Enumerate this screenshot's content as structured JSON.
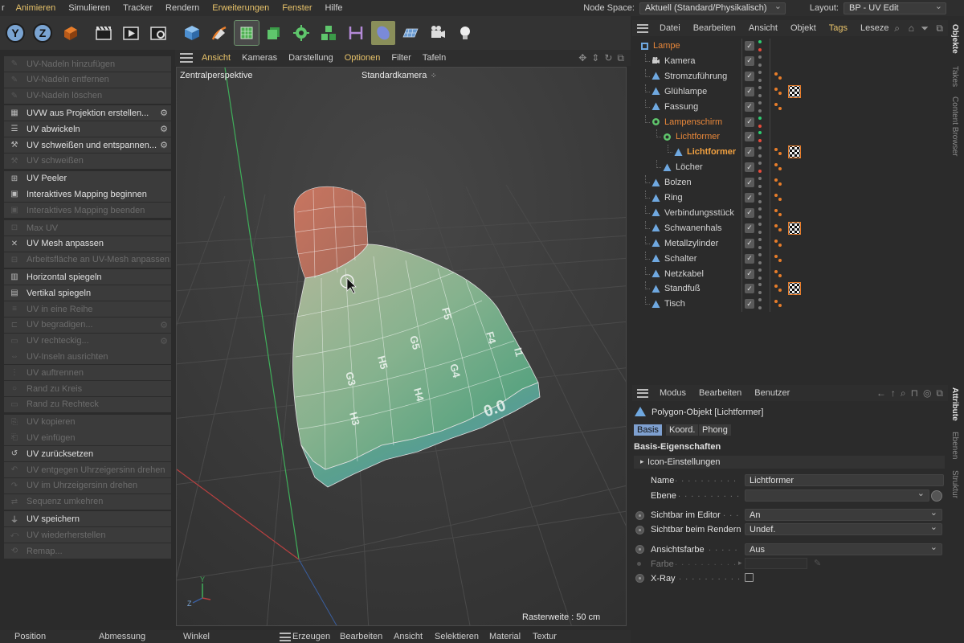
{
  "menubar": {
    "items": [
      "r",
      "Animieren",
      "Simulieren",
      "Tracker",
      "Rendern",
      "Erweiterungen",
      "Fenster",
      "Hilfe"
    ],
    "node_space_label": "Node Space:",
    "node_space_value": "Aktuell (Standard/Physikalisch)",
    "layout_label": "Layout:",
    "layout_value": "BP - UV Edit"
  },
  "toolbar": {
    "icons": [
      "axis-y-icon",
      "axis-z-icon",
      "coordinate-system-icon",
      "clapperboard-icon",
      "render-view-icon",
      "render-settings-icon",
      "cube-icon",
      "pen-icon",
      "subdivision-icon",
      "extrude-icon",
      "cloner-icon",
      "mograph-icon",
      "deformer-icon",
      "environment-icon",
      "floor-icon",
      "camera-icon",
      "light-icon"
    ],
    "axis_y": "Y",
    "axis_z": "Z"
  },
  "uv_panel": {
    "commands": [
      {
        "label": "UV-Nadeln hinzufügen",
        "enabled": false,
        "gear": false,
        "icon": "pin-icon"
      },
      {
        "label": "UV-Nadeln entfernen",
        "enabled": false,
        "gear": false,
        "icon": "pin-icon"
      },
      {
        "label": "UV-Nadeln löschen",
        "enabled": false,
        "gear": false,
        "icon": "pin-icon"
      },
      {
        "label": "UVW aus Projektion erstellen...",
        "enabled": true,
        "gear": true,
        "icon": "checker-icon"
      },
      {
        "label": "UV abwickeln",
        "enabled": true,
        "gear": true,
        "icon": "unwrap-icon"
      },
      {
        "label": "UV schweißen und entspannen...",
        "enabled": true,
        "gear": true,
        "icon": "weld-icon"
      },
      {
        "label": "UV schweißen",
        "enabled": false,
        "gear": false,
        "icon": "weld-icon"
      },
      {
        "label": "UV Peeler",
        "enabled": true,
        "gear": false,
        "icon": "peeler-icon"
      },
      {
        "label": "Interaktives Mapping beginnen",
        "enabled": true,
        "gear": false,
        "icon": "mapping-icon"
      },
      {
        "label": "Interaktives Mapping beenden",
        "enabled": false,
        "gear": false,
        "icon": "mapping-icon"
      },
      {
        "label": "Max UV",
        "enabled": false,
        "gear": false,
        "icon": "max-uv-icon"
      },
      {
        "label": "UV Mesh anpassen",
        "enabled": true,
        "gear": false,
        "icon": "fit-mesh-icon"
      },
      {
        "label": "Arbeitsfläche an UV-Mesh anpassen",
        "enabled": false,
        "gear": false,
        "icon": "fit-canvas-icon"
      },
      {
        "label": "Horizontal spiegeln",
        "enabled": true,
        "gear": false,
        "icon": "mirror-h-icon"
      },
      {
        "label": "Vertikal spiegeln",
        "enabled": true,
        "gear": false,
        "icon": "mirror-v-icon"
      },
      {
        "label": "UV in eine Reihe",
        "enabled": false,
        "gear": false,
        "icon": "row-icon"
      },
      {
        "label": "UV begradigen...",
        "enabled": false,
        "gear": true,
        "icon": "straighten-icon"
      },
      {
        "label": "UV rechteckig...",
        "enabled": false,
        "gear": true,
        "icon": "rect-icon"
      },
      {
        "label": "UV-Inseln ausrichten",
        "enabled": false,
        "gear": false,
        "icon": "align-icon"
      },
      {
        "label": "UV auftrennen",
        "enabled": false,
        "gear": false,
        "icon": "split-icon"
      },
      {
        "label": "Rand zu Kreis",
        "enabled": false,
        "gear": false,
        "icon": "circle-icon"
      },
      {
        "label": "Rand zu Rechteck",
        "enabled": false,
        "gear": false,
        "icon": "rect-icon"
      },
      {
        "label": "UV kopieren",
        "enabled": false,
        "gear": false,
        "icon": "copy-icon"
      },
      {
        "label": "UV einfügen",
        "enabled": false,
        "gear": false,
        "icon": "paste-icon"
      },
      {
        "label": "UV zurücksetzen",
        "enabled": true,
        "gear": false,
        "icon": "reset-icon"
      },
      {
        "label": "UV entgegen Uhrzeigersinn drehen",
        "enabled": false,
        "gear": false,
        "icon": "rotate-ccw-icon"
      },
      {
        "label": "UV im Uhrzeigersinn drehen",
        "enabled": false,
        "gear": false,
        "icon": "rotate-cw-icon"
      },
      {
        "label": "Sequenz umkehren",
        "enabled": false,
        "gear": false,
        "icon": "reverse-icon"
      },
      {
        "label": "UV speichern",
        "enabled": true,
        "gear": false,
        "icon": "save-icon"
      },
      {
        "label": "UV wiederherstellen",
        "enabled": false,
        "gear": false,
        "icon": "restore-icon"
      },
      {
        "label": "Remap...",
        "enabled": false,
        "gear": false,
        "icon": "remap-icon"
      }
    ]
  },
  "viewport": {
    "menu": [
      {
        "label": "Ansicht",
        "highlight": true
      },
      {
        "label": "Kameras",
        "highlight": false
      },
      {
        "label": "Darstellung",
        "highlight": false
      },
      {
        "label": "Optionen",
        "highlight": true
      },
      {
        "label": "Filter",
        "highlight": false
      },
      {
        "label": "Tafeln",
        "highlight": false
      }
    ],
    "perspective_label": "Zentralperspektive",
    "camera_label": "Standardkamera",
    "grid_label": "Rasterweite : 50 cm",
    "axis_y": "Y",
    "axis_z": "Z",
    "uv_labels": [
      "F5",
      "G5",
      "H5",
      "F4",
      "G4",
      "H4",
      "G3",
      "H3",
      "I1",
      "0.0"
    ]
  },
  "bottombar": {
    "left": [
      "Position",
      "Abmessung",
      "Winkel"
    ],
    "menu": [
      "Erzeugen",
      "Bearbeiten",
      "Ansicht",
      "Selektieren",
      "Material",
      "Textur"
    ]
  },
  "objects": {
    "menu": [
      {
        "label": "Datei",
        "highlight": false
      },
      {
        "label": "Bearbeiten",
        "highlight": false
      },
      {
        "label": "Ansicht",
        "highlight": false
      },
      {
        "label": "Objekt",
        "highlight": false
      },
      {
        "label": "Tags",
        "highlight": true
      },
      {
        "label": "Leseze",
        "highlight": false
      }
    ],
    "tree": [
      {
        "label": "Lampe",
        "depth": 0,
        "style": "orange",
        "icon": "null-icon",
        "dots": [
          "#2ecc71",
          "#e74c3c"
        ],
        "tags": 0,
        "tex": false,
        "check": true
      },
      {
        "label": "Kamera",
        "depth": 1,
        "style": "normal",
        "icon": "camera-icon",
        "dots": [
          "#777",
          "#777"
        ],
        "tags": 0,
        "tex": false,
        "check": true
      },
      {
        "label": "Stromzuführung",
        "depth": 1,
        "style": "normal",
        "icon": "polygon-icon",
        "dots": [
          "#777",
          "#777"
        ],
        "tags": 1,
        "tex": false,
        "check": true
      },
      {
        "label": "Glühlampe",
        "depth": 1,
        "style": "normal",
        "icon": "polygon-icon",
        "dots": [
          "#777",
          "#777"
        ],
        "tags": 1,
        "tex": true,
        "check": true
      },
      {
        "label": "Fassung",
        "depth": 1,
        "style": "normal",
        "icon": "polygon-icon",
        "dots": [
          "#777",
          "#777"
        ],
        "tags": 1,
        "tex": false,
        "check": true
      },
      {
        "label": "Lampenschirm",
        "depth": 1,
        "style": "orange",
        "icon": "subdivision-icon",
        "dots": [
          "#2ecc71",
          "#e74c3c"
        ],
        "tags": 0,
        "tex": false,
        "check": true
      },
      {
        "label": "Lichtformer",
        "depth": 2,
        "style": "orange",
        "icon": "subdivision-icon",
        "dots": [
          "#2ecc71",
          "#e74c3c"
        ],
        "tags": 0,
        "tex": false,
        "check": true
      },
      {
        "label": "Lichtformer",
        "depth": 3,
        "style": "bright",
        "icon": "polygon-icon",
        "dots": [
          "#777",
          "#777"
        ],
        "tags": 1,
        "tex": true,
        "check": true
      },
      {
        "label": "Löcher",
        "depth": 2,
        "style": "normal",
        "icon": "polygon-icon",
        "dots": [
          "#777",
          "#e74c3c"
        ],
        "tags": 1,
        "tex": false,
        "check": true
      },
      {
        "label": "Bolzen",
        "depth": 1,
        "style": "normal",
        "icon": "polygon-icon",
        "dots": [
          "#777",
          "#777"
        ],
        "tags": 1,
        "tex": false,
        "check": true
      },
      {
        "label": "Ring",
        "depth": 1,
        "style": "normal",
        "icon": "polygon-icon",
        "dots": [
          "#777",
          "#777"
        ],
        "tags": 1,
        "tex": false,
        "check": true
      },
      {
        "label": "Verbindungsstück",
        "depth": 1,
        "style": "normal",
        "icon": "polygon-icon",
        "dots": [
          "#777",
          "#777"
        ],
        "tags": 1,
        "tex": false,
        "check": true
      },
      {
        "label": "Schwanenhals",
        "depth": 1,
        "style": "normal",
        "icon": "polygon-icon",
        "dots": [
          "#777",
          "#777"
        ],
        "tags": 1,
        "tex": true,
        "check": true
      },
      {
        "label": "Metallzylinder",
        "depth": 1,
        "style": "normal",
        "icon": "polygon-icon",
        "dots": [
          "#777",
          "#777"
        ],
        "tags": 1,
        "tex": false,
        "check": true
      },
      {
        "label": "Schalter",
        "depth": 1,
        "style": "normal",
        "icon": "polygon-icon",
        "dots": [
          "#777",
          "#777"
        ],
        "tags": 1,
        "tex": false,
        "check": true
      },
      {
        "label": "Netzkabel",
        "depth": 1,
        "style": "normal",
        "icon": "polygon-icon",
        "dots": [
          "#777",
          "#777"
        ],
        "tags": 1,
        "tex": false,
        "check": true
      },
      {
        "label": "Standfuß",
        "depth": 1,
        "style": "normal",
        "icon": "polygon-icon",
        "dots": [
          "#777",
          "#777"
        ],
        "tags": 1,
        "tex": true,
        "check": true
      },
      {
        "label": "Tisch",
        "depth": 1,
        "style": "normal",
        "icon": "polygon-icon",
        "dots": [
          "#777",
          "#777"
        ],
        "tags": 1,
        "tex": false,
        "check": true
      }
    ]
  },
  "attributes": {
    "menu": [
      "Modus",
      "Bearbeiten",
      "Benutzer"
    ],
    "object_title": "Polygon-Objekt [Lichtformer]",
    "tabs": [
      {
        "label": "Basis",
        "active": true
      },
      {
        "label": "Koord.",
        "active": false
      },
      {
        "label": "Phong",
        "active": false
      }
    ],
    "section_title": "Basis-Eigenschaften",
    "icon_settings": "Icon-Einstellungen",
    "name_label": "Name",
    "name_value": "Lichtformer",
    "layer_label": "Ebene",
    "visible_editor_label": "Sichtbar im Editor",
    "visible_editor_value": "An",
    "visible_render_label": "Sichtbar beim Rendern",
    "visible_render_value": "Undef.",
    "view_color_label": "Ansichtsfarbe",
    "view_color_value": "Aus",
    "color_label": "Farbe",
    "xray_label": "X-Ray"
  },
  "side_tabs": {
    "top": [
      "Objekte",
      "Takes",
      "Content Browser"
    ],
    "bottom": [
      "Attribute",
      "Ebenen",
      "Struktur"
    ]
  },
  "colors": {
    "accent_orange": "#e8873a",
    "menu_highlight": "#e8c36a",
    "tab_active": "#7ea0d0",
    "grid_green_axis": "#3fae5a",
    "grid_red_axis": "#b84040"
  }
}
